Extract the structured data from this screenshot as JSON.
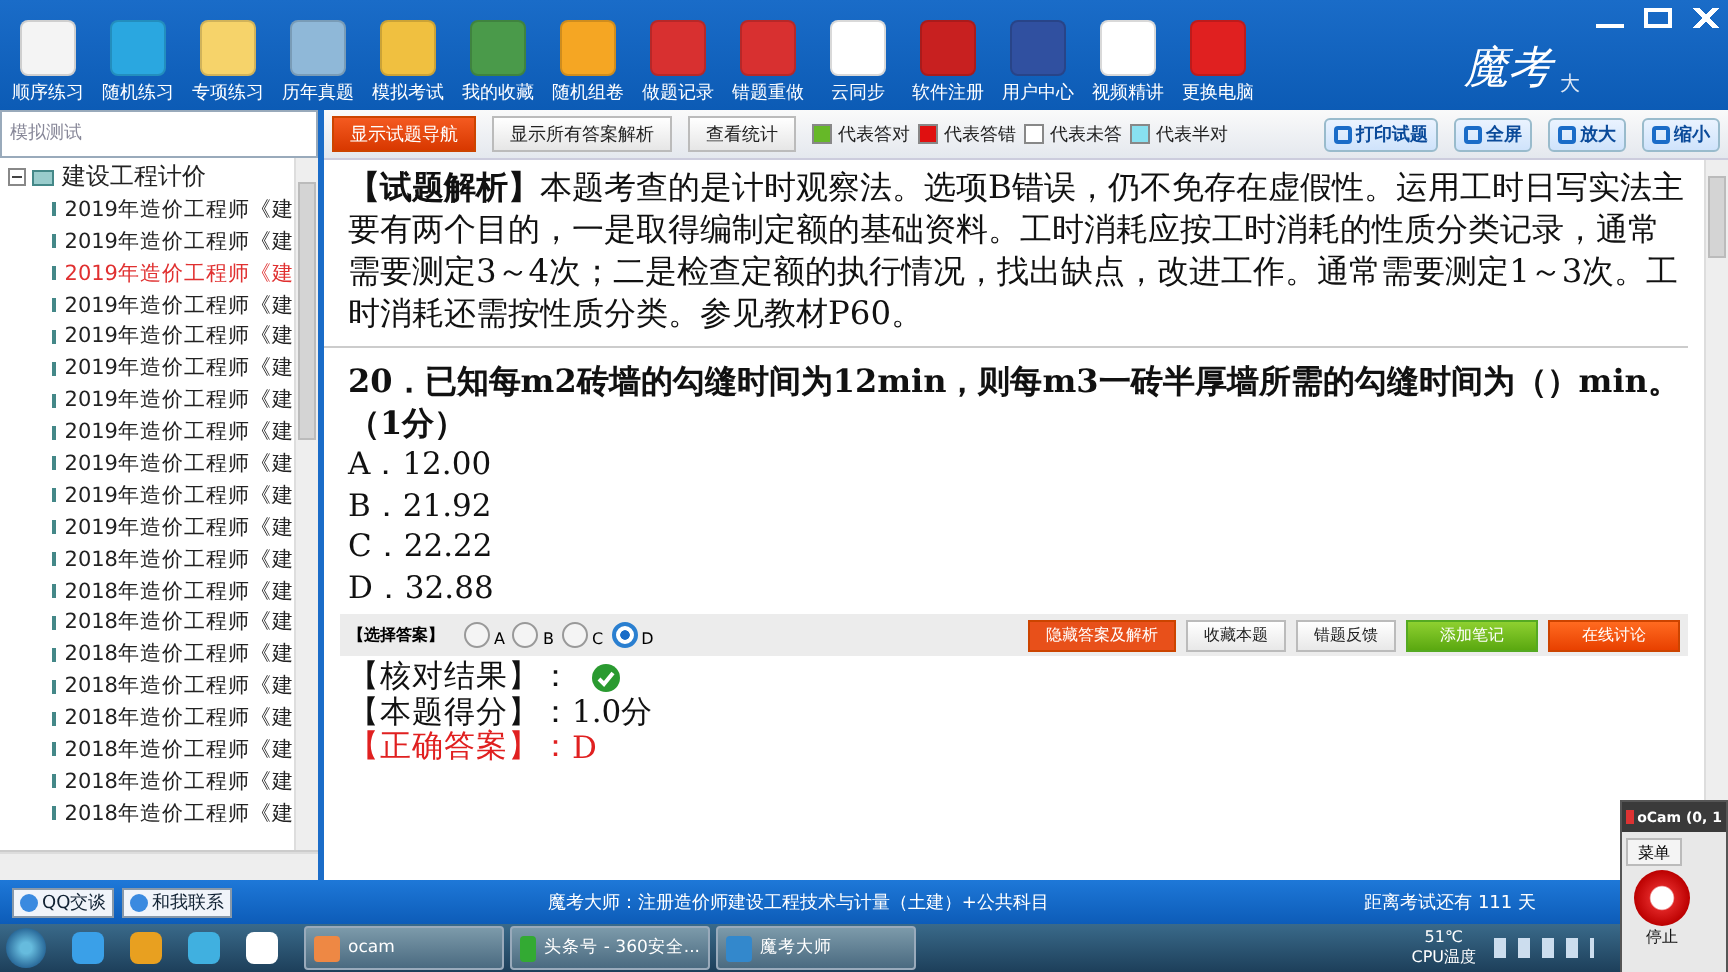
{
  "toolbar": {
    "items": [
      {
        "label": "顺序练习"
      },
      {
        "label": "随机练习"
      },
      {
        "label": "专项练习"
      },
      {
        "label": "历年真题"
      },
      {
        "label": "模拟考试"
      },
      {
        "label": "我的收藏"
      },
      {
        "label": "随机组卷"
      },
      {
        "label": "做题记录"
      },
      {
        "label": "错题重做"
      },
      {
        "label": "云同步"
      },
      {
        "label": "软件注册"
      },
      {
        "label": "用户中心"
      },
      {
        "label": "视频精讲"
      },
      {
        "label": "更换电脑"
      }
    ],
    "logo": "魔考",
    "logo_tail": "大"
  },
  "sidebar": {
    "search": {
      "placeholder": "模拟测试"
    },
    "tree": {
      "label": "建设工程计价",
      "expanded": true,
      "children": [
        {
          "label": "2019年造价工程师《建",
          "selected": false
        },
        {
          "label": "2019年造价工程师《建",
          "selected": false
        },
        {
          "label": "2019年造价工程师《建",
          "selected": true
        },
        {
          "label": "2019年造价工程师《建",
          "selected": false
        },
        {
          "label": "2019年造价工程师《建",
          "selected": false
        },
        {
          "label": "2019年造价工程师《建",
          "selected": false
        },
        {
          "label": "2019年造价工程师《建",
          "selected": false
        },
        {
          "label": "2019年造价工程师《建",
          "selected": false
        },
        {
          "label": "2019年造价工程师《建",
          "selected": false
        },
        {
          "label": "2019年造价工程师《建",
          "selected": false
        },
        {
          "label": "2019年造价工程师《建",
          "selected": false
        },
        {
          "label": "2018年造价工程师《建",
          "selected": false
        },
        {
          "label": "2018年造价工程师《建",
          "selected": false
        },
        {
          "label": "2018年造价工程师《建",
          "selected": false
        },
        {
          "label": "2018年造价工程师《建",
          "selected": false
        },
        {
          "label": "2018年造价工程师《建",
          "selected": false
        },
        {
          "label": "2018年造价工程师《建",
          "selected": false
        },
        {
          "label": "2018年造价工程师《建",
          "selected": false
        },
        {
          "label": "2018年造价工程师《建",
          "selected": false
        },
        {
          "label": "2018年造价工程师《建",
          "selected": false
        }
      ]
    }
  },
  "action_bar": {
    "buttons": [
      {
        "label": "显示试题导航",
        "selected": true
      },
      {
        "label": "显示所有答案解析",
        "selected": false
      },
      {
        "label": "查看统计",
        "selected": false
      }
    ],
    "legend": [
      {
        "label": "代表答对",
        "color": "#66b828"
      },
      {
        "label": "代表答错",
        "color": "#e01010"
      },
      {
        "label": "代表未答",
        "color": "#ffffff"
      },
      {
        "label": "代表半对",
        "color": "#88e0f0"
      }
    ],
    "tools": [
      {
        "label": "打印试题"
      },
      {
        "label": "全屏"
      },
      {
        "label": "放大"
      },
      {
        "label": "缩小"
      }
    ]
  },
  "explanation": "**【试题解析】**本题考查的是计时观察法。选项B错误，仍不免存在虚假性。运用工时日写实法主要有两个目的，一是取得编制定额的基础资料。工时消耗应按工时消耗的性质分类记录，通常需要测定3～4次；二是检查定额的执行情况，找出缺点，改进工作。通常需要测定1～3次。工时消耗还需按性质分类。参见教材P60。",
  "question": {
    "text": "20．已知每m2砖墙的勾缝时间为12min，则每m3一砖半厚墙所需的勾缝时间为（）min。（1分）",
    "options": [
      "A．12.00",
      "B．21.92",
      "C．22.22",
      "D．32.88"
    ]
  },
  "answer_bar": {
    "label": "【选择答案】",
    "choices": [
      {
        "label": "A",
        "selected": false
      },
      {
        "label": "B",
        "selected": false
      },
      {
        "label": "C",
        "selected": false
      },
      {
        "label": "D",
        "selected": true
      }
    ],
    "buttons": [
      {
        "label": "隐藏答案及解析",
        "kind": "orange"
      },
      {
        "label": "收藏本题",
        "kind": "plain"
      },
      {
        "label": "错题反馈",
        "kind": "plain"
      },
      {
        "label": "添加笔记",
        "kind": "green"
      },
      {
        "label": "在线讨论",
        "kind": "red"
      }
    ]
  },
  "result": {
    "check_label": "【核对结果】：",
    "correct": true,
    "score_label": "【本题得分】：",
    "score": "1.0分",
    "answer_label": "【正确答案】：",
    "answer": "D"
  },
  "status_bar": {
    "buttons": [
      "QQ交谈",
      "和我联系"
    ],
    "title": "魔考大师：注册造价师建设工程技术与计量（土建）+公共科目",
    "countdown": "距离考试还有 111 天"
  },
  "taskbar": {
    "tasks": [
      {
        "label": "ocam"
      },
      {
        "label": "头条号 - 360安全..."
      },
      {
        "label": "魔考大师"
      }
    ],
    "temp": "51℃",
    "temp_label": "CPU温度"
  },
  "ocam": {
    "title": "oCam (0, 1",
    "menu": "菜单",
    "stop": "停止"
  }
}
